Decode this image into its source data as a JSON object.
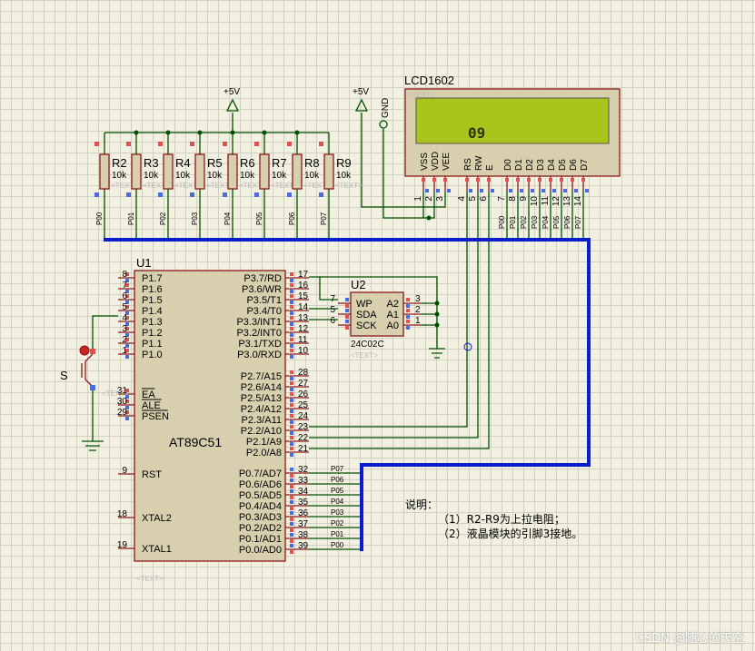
{
  "power": {
    "vcc1": "+5V",
    "vcc2": "+5V",
    "gnd": "GND"
  },
  "resistors": [
    {
      "ref": "R2",
      "value": "10k",
      "net": "P00"
    },
    {
      "ref": "R3",
      "value": "10k",
      "net": "P01"
    },
    {
      "ref": "R4",
      "value": "10k",
      "net": "P02"
    },
    {
      "ref": "R5",
      "value": "10k",
      "net": "P03"
    },
    {
      "ref": "R6",
      "value": "10k",
      "net": "P04"
    },
    {
      "ref": "R7",
      "value": "10k",
      "net": "P05"
    },
    {
      "ref": "R8",
      "value": "10k",
      "net": "P06"
    },
    {
      "ref": "R9",
      "value": "10k",
      "net": "P07"
    }
  ],
  "text_tag": "<TEXT>",
  "lcd": {
    "name": "LCD1602",
    "display": "09",
    "pins": [
      {
        "name": "VSS",
        "num": "1"
      },
      {
        "name": "VDD",
        "num": "2"
      },
      {
        "name": "VEE",
        "num": "3"
      },
      {
        "name": "RS",
        "num": "4"
      },
      {
        "name": "RW",
        "num": "5"
      },
      {
        "name": "E",
        "num": "6"
      },
      {
        "name": "D0",
        "num": "7"
      },
      {
        "name": "D1",
        "num": "8"
      },
      {
        "name": "D2",
        "num": "9"
      },
      {
        "name": "D3",
        "num": "10"
      },
      {
        "name": "D4",
        "num": "11"
      },
      {
        "name": "D5",
        "num": "12"
      },
      {
        "name": "D6",
        "num": "13"
      },
      {
        "name": "D7",
        "num": "14"
      }
    ],
    "nets": [
      "P00",
      "P01",
      "P02",
      "P03",
      "P04",
      "P05",
      "P06",
      "P07"
    ]
  },
  "eeprom": {
    "ref": "U2",
    "part": "24C02C",
    "left_pins": [
      {
        "name": "WP",
        "num": "7"
      },
      {
        "name": "SDA",
        "num": "5"
      },
      {
        "name": "SCK",
        "num": "6"
      }
    ],
    "right_pins": [
      {
        "name": "A2",
        "num": "3"
      },
      {
        "name": "A1",
        "num": "2"
      },
      {
        "name": "A0",
        "num": "1"
      }
    ]
  },
  "mcu": {
    "ref": "U1",
    "part": "AT89C51",
    "left_pins": [
      {
        "name": "P1.7",
        "num": "8"
      },
      {
        "name": "P1.6",
        "num": "7"
      },
      {
        "name": "P1.5",
        "num": "6"
      },
      {
        "name": "P1.4",
        "num": "5"
      },
      {
        "name": "P1.3",
        "num": "4"
      },
      {
        "name": "P1.2",
        "num": "3"
      },
      {
        "name": "P1.1",
        "num": "2"
      },
      {
        "name": "P1.0",
        "num": "1"
      },
      {
        "name": "EA",
        "num": "31"
      },
      {
        "name": "ALE",
        "num": "30"
      },
      {
        "name": "PSEN",
        "num": "29"
      },
      {
        "name": "RST",
        "num": "9"
      },
      {
        "name": "XTAL2",
        "num": "18"
      },
      {
        "name": "XTAL1",
        "num": "19"
      }
    ],
    "right_pins": [
      {
        "name": "P3.7/RD",
        "num": "17"
      },
      {
        "name": "P3.6/WR",
        "num": "16"
      },
      {
        "name": "P3.5/T1",
        "num": "15"
      },
      {
        "name": "P3.4/T0",
        "num": "14"
      },
      {
        "name": "P3.3/INT1",
        "num": "13"
      },
      {
        "name": "P3.2/INT0",
        "num": "12"
      },
      {
        "name": "P3.1/TXD",
        "num": "11"
      },
      {
        "name": "P3.0/RXD",
        "num": "10"
      },
      {
        "name": "P2.7/A15",
        "num": "28"
      },
      {
        "name": "P2.6/A14",
        "num": "27"
      },
      {
        "name": "P2.5/A13",
        "num": "26"
      },
      {
        "name": "P2.4/A12",
        "num": "25"
      },
      {
        "name": "P2.3/A11",
        "num": "24"
      },
      {
        "name": "P2.2/A10",
        "num": "23"
      },
      {
        "name": "P2.1/A9",
        "num": "22"
      },
      {
        "name": "P2.0/A8",
        "num": "21"
      },
      {
        "name": "P0.7/AD7",
        "num": "32"
      },
      {
        "name": "P0.6/AD6",
        "num": "33"
      },
      {
        "name": "P0.5/AD5",
        "num": "34"
      },
      {
        "name": "P0.4/AD4",
        "num": "35"
      },
      {
        "name": "P0.3/AD3",
        "num": "36"
      },
      {
        "name": "P0.2/AD2",
        "num": "37"
      },
      {
        "name": "P0.1/AD1",
        "num": "38"
      },
      {
        "name": "P0.0/AD0",
        "num": "39"
      }
    ],
    "p0_nets": [
      "P07",
      "P06",
      "P05",
      "P04",
      "P03",
      "P02",
      "P01",
      "P00"
    ]
  },
  "switch": {
    "ref": "S"
  },
  "notes": {
    "title": "说明：",
    "line1": "（1）R2-R9为上拉电阻；",
    "line2": "（2）液晶模块的引脚3接地。"
  },
  "watermark": "CSDN @随心的天空"
}
